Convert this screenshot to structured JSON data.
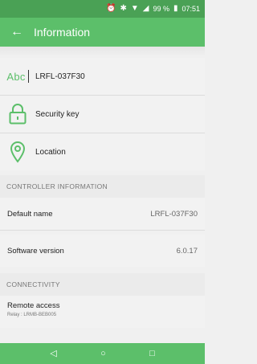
{
  "status_bar": {
    "icons": [
      "alarm-icon",
      "bluetooth-icon",
      "wifi-icon",
      "signal-icon",
      "battery-icon"
    ],
    "battery": "99 %",
    "time": "07:51"
  },
  "app_bar": {
    "back_icon": "arrow-left-icon",
    "title": "Information"
  },
  "info_rows": {
    "name": {
      "icon_text": "Abc",
      "value": "LRFL-037F30"
    },
    "security": {
      "label": "Security key"
    },
    "location": {
      "label": "Location"
    }
  },
  "controller_info": {
    "header": "CONTROLLER INFORMATION",
    "default_name": {
      "label": "Default name",
      "value": "LRFL-037F30"
    },
    "software_version": {
      "label": "Software version",
      "value": "6.0.17"
    }
  },
  "connectivity": {
    "header": "CONNECTIVITY",
    "remote_access": {
      "label": "Remote access",
      "relay": "Relay : LRMB-BEB005"
    }
  },
  "nav_bar": {
    "back": "◁",
    "home": "○",
    "recents": "□"
  },
  "colors": {
    "accent": "#5cbf6a",
    "status_bar": "#4aa155"
  }
}
